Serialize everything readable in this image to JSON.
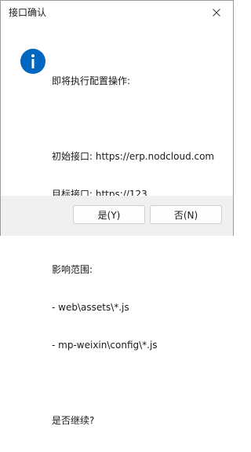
{
  "window": {
    "title": "接口确认",
    "close_icon": "close-icon"
  },
  "icon": {
    "name": "info-icon",
    "color": "#0067c0",
    "glyph": "i"
  },
  "message": {
    "heading": "即将执行配置操作:",
    "source_line": "初始接口: https://erp.nodcloud.com",
    "target_line": "目标接口: https://123",
    "scope_heading": "影响范围:",
    "scope_items": [
      "- web\\assets\\*.js",
      "- mp-weixin\\config\\*.js"
    ],
    "question": "是否继续?"
  },
  "buttons": {
    "yes_label": "是(Y)",
    "no_label": "否(N)"
  }
}
